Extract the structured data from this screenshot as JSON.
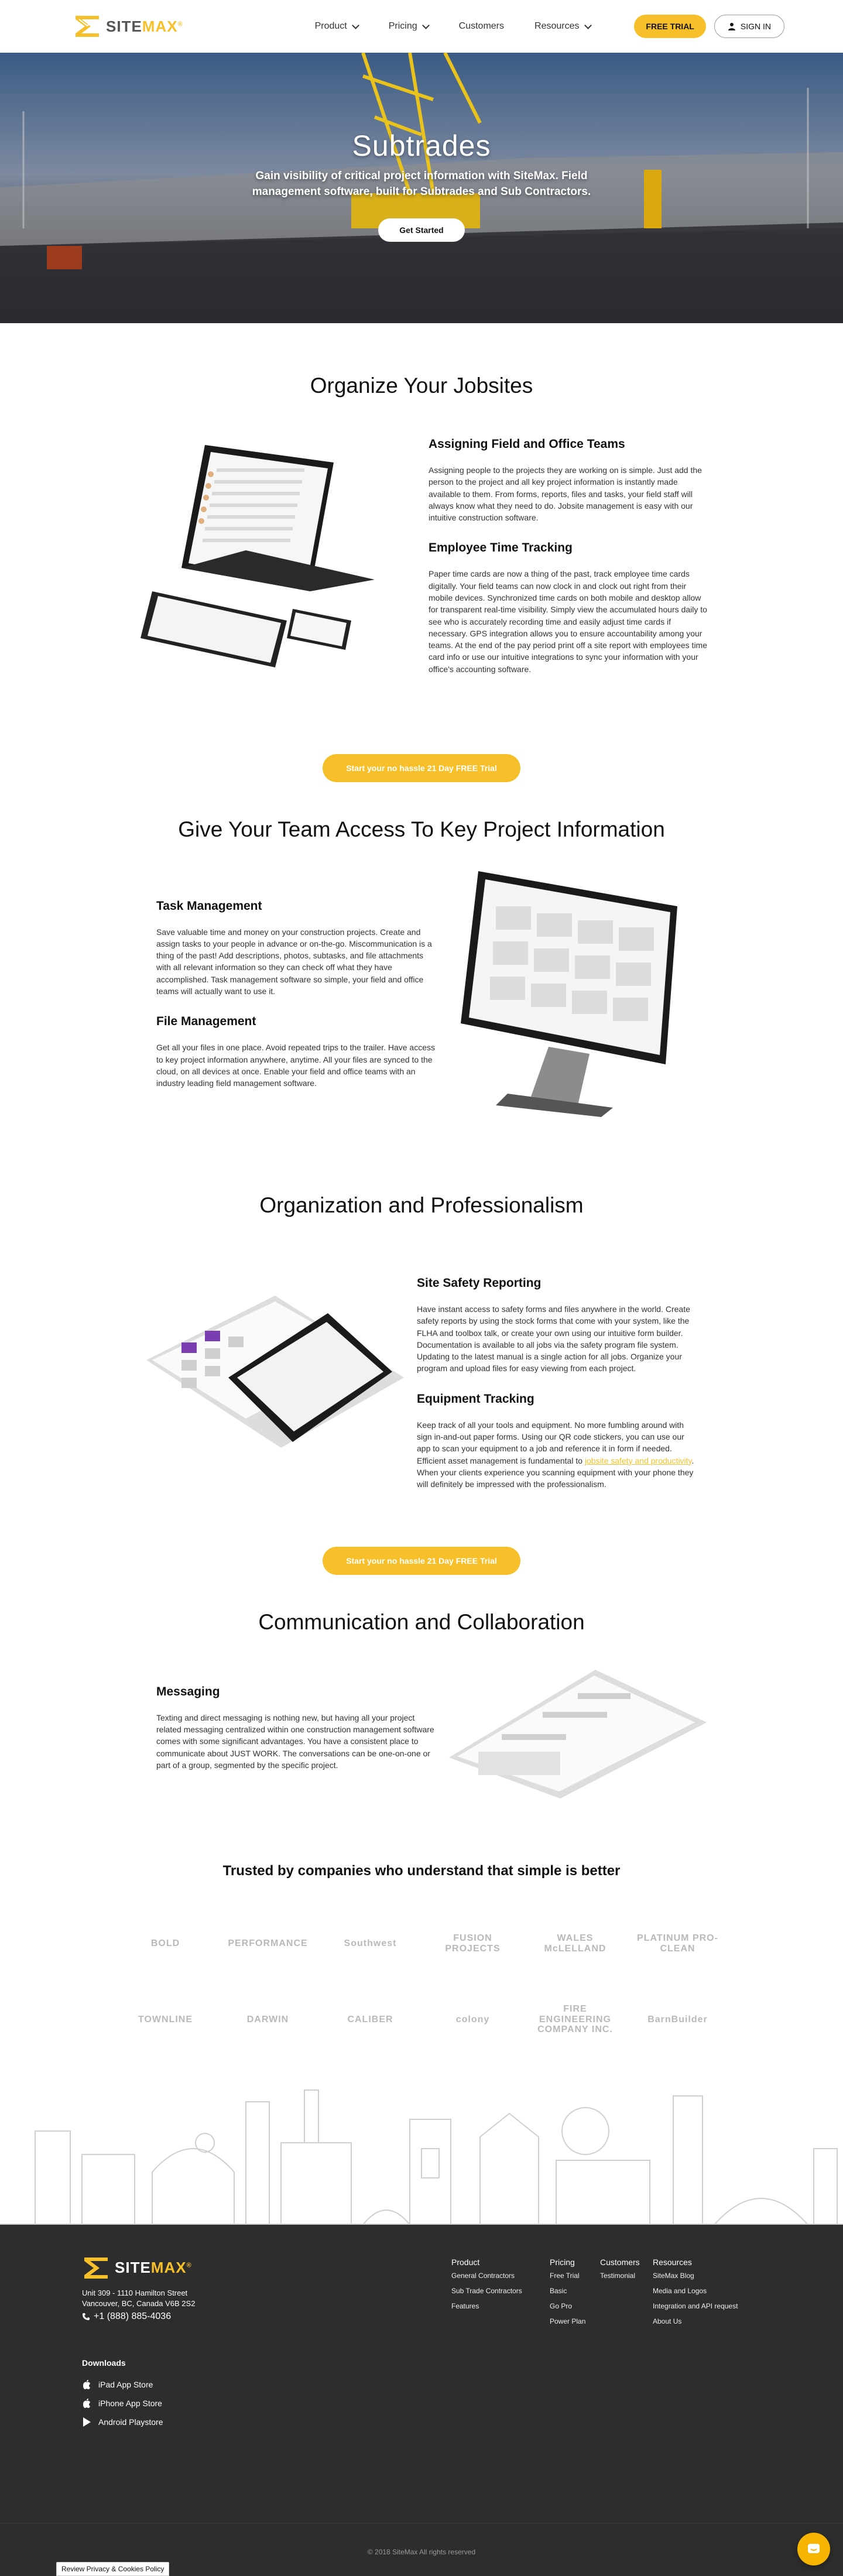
{
  "header": {
    "logo_text_site": "SITE",
    "logo_text_max": "MAX",
    "logo_reg": "®",
    "nav": [
      {
        "label": "Product"
      },
      {
        "label": "Pricing"
      },
      {
        "label": "Customers"
      },
      {
        "label": "Resources"
      }
    ],
    "trial_label": "FREE TRIAL",
    "signin_label": "SIGN IN"
  },
  "hero": {
    "title": "Subtrades",
    "subtitle": "Gain visibility of critical project information with SiteMax. Field management software, built for Subtrades and Sub Contractors.",
    "cta": "Get Started"
  },
  "section_jobsites": {
    "title": "Organize Your Jobsites",
    "features": [
      {
        "heading": "Assigning Field and Office Teams",
        "body": "Assigning people to the projects they are working on is simple. Just add the person to the project and all key project information is instantly made available to them. From forms, reports, files and tasks, your field staff will always know what they need to do. Jobsite management is easy with our intuitive construction software."
      },
      {
        "heading": "Employee Time Tracking",
        "body": "Paper time cards are now a thing of the past, track employee time cards digitally. Your field teams can now clock in and clock out right from their mobile devices. Synchronized time cards on both mobile and desktop allow for transparent real-time visibility. Simply view the accumulated hours daily to see who is accurately recording time and easily adjust time cards if necessary. GPS integration allows you to ensure accountability among your teams. At the end of the pay period print off a site report with employees time card info or use our intuitive integrations to sync your information with your office's accounting software."
      }
    ],
    "cta": "Start your no hassle 21 Day FREE Trial"
  },
  "section_access": {
    "title": "Give Your Team Access To Key Project Information",
    "features": [
      {
        "heading": "Task Management",
        "body": "Save valuable time and money on your construction projects. Create and assign tasks to your people in advance or on-the-go. Miscommunication is a thing of the past! Add descriptions, photos, subtasks, and file attachments with all relevant information so they can check off what they have accomplished. Task management software so simple, your field and office teams will actually want to use it."
      },
      {
        "heading": "File Management",
        "body": "Get all your files in one place. Avoid repeated trips to the trailer. Have access to key project information anywhere, anytime. All your files are synced to the cloud, on all devices at once. Enable your field and office teams with an industry leading field management software."
      }
    ]
  },
  "section_org": {
    "title": "Organization and Professionalism",
    "features": [
      {
        "heading": "Site Safety Reporting",
        "body": "Have instant access to safety forms and files anywhere in the world. Create safety reports by using the stock forms that come with your system, like the FLHA and toolbox talk, or create your own using our intuitive form builder. Documentation is available to all jobs via the safety program file system. Updating to the latest manual is a single action for all jobs. Organize your program and upload files for easy viewing from each project."
      },
      {
        "heading": "Equipment Tracking",
        "body_before": "Keep track of all your tools and equipment. No more fumbling around with sign in-and-out paper forms. Using our QR code stickers, you can use our app to scan your equipment to a job and reference it in form if needed. Efficient asset management is fundamental to ",
        "link": "jobsite safety and productivity",
        "body_after": ". When your clients experience you scanning equipment with your phone they will definitely be impressed with the professionalism."
      }
    ],
    "cta": "Start your no hassle 21 Day FREE Trial"
  },
  "section_comm": {
    "title": "Communication and Collaboration",
    "features": [
      {
        "heading": "Messaging",
        "body": "Texting and direct messaging is nothing new, but having all your project related messaging centralized within one construction management software comes with some significant advantages. You have a consistent place to communicate about JUST WORK. The conversations can be one-on-one or part of a group, segmented by the specific project."
      }
    ]
  },
  "trusted": {
    "title": "Trusted by companies who understand that simple is better",
    "row1": [
      "BOLD",
      "PERFORMANCE",
      "Southwest",
      "FUSION PROJECTS",
      "WALES McLELLAND",
      "PLATINUM PRO-CLEAN"
    ],
    "row2": [
      "TOWNLINE",
      "DARWIN",
      "CALIBER",
      "colony",
      "FIRE ENGINEERING COMPANY INC.",
      "BarnBuilder"
    ]
  },
  "footer": {
    "address_line1": "Unit 309 - 1110 Hamilton Street",
    "address_line2": "Vancouver, BC, Canada V6B 2S2",
    "phone": "+1 (888) 885-4036",
    "downloads_title": "Downloads",
    "downloads": [
      "iPad App Store",
      "iPhone App Store",
      "Android Playstore"
    ],
    "columns": [
      {
        "heading": "Product",
        "links": [
          "General Contractors",
          "Sub Trade Contractors",
          "Features"
        ]
      },
      {
        "heading": "Pricing",
        "links": [
          "Free Trial",
          "Basic",
          "Go Pro",
          "Power Plan"
        ]
      },
      {
        "heading": "Customers",
        "links": [
          "Testimonial"
        ]
      },
      {
        "heading": "Resources",
        "links": [
          "SiteMax Blog",
          "Media and Logos",
          "Integration and API request",
          "About Us"
        ]
      }
    ],
    "copyright": "© 2018 SiteMax All rights reserved",
    "privacy": "Review Privacy & Cookies Policy"
  },
  "colors": {
    "accent": "#f7c02b",
    "footer_bg": "#2d2d2d"
  }
}
